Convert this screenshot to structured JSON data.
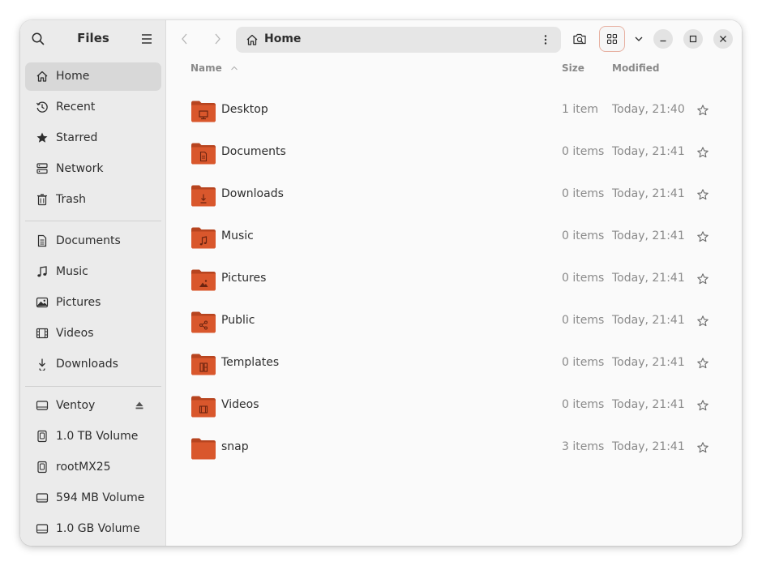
{
  "sidebar": {
    "title": "Files",
    "places": [
      {
        "label": "Home",
        "icon": "home-icon",
        "active": true
      },
      {
        "label": "Recent",
        "icon": "clock-icon"
      },
      {
        "label": "Starred",
        "icon": "star-icon"
      },
      {
        "label": "Network",
        "icon": "network-icon"
      },
      {
        "label": "Trash",
        "icon": "trash-icon"
      }
    ],
    "bookmarks": [
      {
        "label": "Documents",
        "icon": "document-icon"
      },
      {
        "label": "Music",
        "icon": "music-icon"
      },
      {
        "label": "Pictures",
        "icon": "picture-icon"
      },
      {
        "label": "Videos",
        "icon": "video-icon"
      },
      {
        "label": "Downloads",
        "icon": "download-icon"
      }
    ],
    "devices": [
      {
        "label": "Ventoy",
        "icon": "drive-icon",
        "eject": true
      },
      {
        "label": "1.0 TB Volume",
        "icon": "disk-icon"
      },
      {
        "label": "rootMX25",
        "icon": "disk-icon"
      },
      {
        "label": "594 MB Volume",
        "icon": "drive-icon"
      },
      {
        "label": "1.0 GB Volume",
        "icon": "drive-icon"
      }
    ]
  },
  "pathbar": {
    "label": "Home"
  },
  "columns": {
    "name": "Name",
    "size": "Size",
    "modified": "Modified"
  },
  "files": [
    {
      "name": "Desktop",
      "size": "1 item",
      "modified": "Today, 21:40",
      "emblem": "desktop"
    },
    {
      "name": "Documents",
      "size": "0 items",
      "modified": "Today, 21:41",
      "emblem": "document"
    },
    {
      "name": "Downloads",
      "size": "0 items",
      "modified": "Today, 21:41",
      "emblem": "download"
    },
    {
      "name": "Music",
      "size": "0 items",
      "modified": "Today, 21:41",
      "emblem": "music"
    },
    {
      "name": "Pictures",
      "size": "0 items",
      "modified": "Today, 21:41",
      "emblem": "picture"
    },
    {
      "name": "Public",
      "size": "0 items",
      "modified": "Today, 21:41",
      "emblem": "share"
    },
    {
      "name": "Templates",
      "size": "0 items",
      "modified": "Today, 21:41",
      "emblem": "template"
    },
    {
      "name": "Videos",
      "size": "0 items",
      "modified": "Today, 21:41",
      "emblem": "video"
    },
    {
      "name": "snap",
      "size": "3 items",
      "modified": "Today, 21:41",
      "emblem": "none"
    }
  ],
  "colors": {
    "folder": "#d9572c",
    "folder_dark": "#b7441f",
    "accent_border": "#e7b1a2"
  }
}
